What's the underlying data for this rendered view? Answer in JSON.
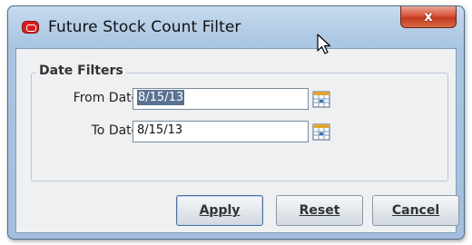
{
  "window": {
    "title": "Future Stock Count Filter",
    "close_label": "x"
  },
  "date_filters": {
    "group_title": "Date Filters",
    "from_label": "From Date:",
    "from_value": "8/15/13",
    "to_label": "To Date:",
    "to_value": "8/15/13"
  },
  "buttons": {
    "apply": "Apply",
    "reset": "Reset",
    "cancel": "Cancel"
  },
  "icons": {
    "app": "oracle-logo-icon",
    "close": "close-icon",
    "calendar": "calendar-icon",
    "cursor": "mouse-pointer-icon"
  },
  "colors": {
    "selection": "#5a7393",
    "title_bar": "#b9d0e8",
    "close_button": "#c43a20"
  }
}
